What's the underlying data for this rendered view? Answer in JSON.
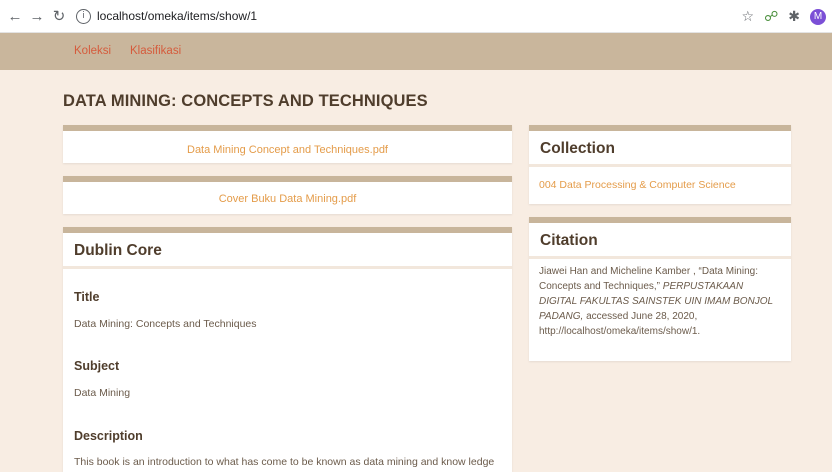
{
  "browser": {
    "url": "localhost/omeka/items/show/1",
    "profile_initial": "M"
  },
  "nav": {
    "items": [
      "Koleksi",
      "Klasifikasi"
    ]
  },
  "item": {
    "title": "DATA MINING: CONCEPTS AND TECHNIQUES",
    "files": [
      "Data Mining Concept and Techniques.pdf",
      "Cover Buku Data Mining.pdf"
    ]
  },
  "dublin_core": {
    "heading": "Dublin Core",
    "fields": [
      {
        "label": "Title",
        "value": "Data Mining: Concepts and Techniques"
      },
      {
        "label": "Subject",
        "value": "Data Mining"
      },
      {
        "label": "Description",
        "value": "This book is an introduction to what has come to be known as data mining and know ledge"
      }
    ]
  },
  "collection": {
    "heading": "Collection",
    "link": "004 Data Processing & Computer Science"
  },
  "citation": {
    "heading": "Citation",
    "authors": "Jiawei Han and Micheline Kamber , “Data Mining: Concepts and Techniques,”",
    "publisher": "PERPUSTAKAAN DIGITAL FAKULTAS SAINSTEK UIN IMAM BONJOL PADANG,",
    "accessed": "accessed June 28, 2020,",
    "url": "http://localhost/omeka/items/show/1."
  },
  "colors": {
    "background": "#f8ede3",
    "nav_bar": "#c9b69c",
    "nav_link": "#d55b3c",
    "file_link": "#e49c4a",
    "card_top_border": "#c8b59b",
    "heading_text": "#4f3d2c"
  },
  "icons": [
    "back-arrow-icon",
    "forward-arrow-icon",
    "reload-icon",
    "info-icon",
    "star-icon",
    "extension-icon",
    "puzzle-icon"
  ]
}
